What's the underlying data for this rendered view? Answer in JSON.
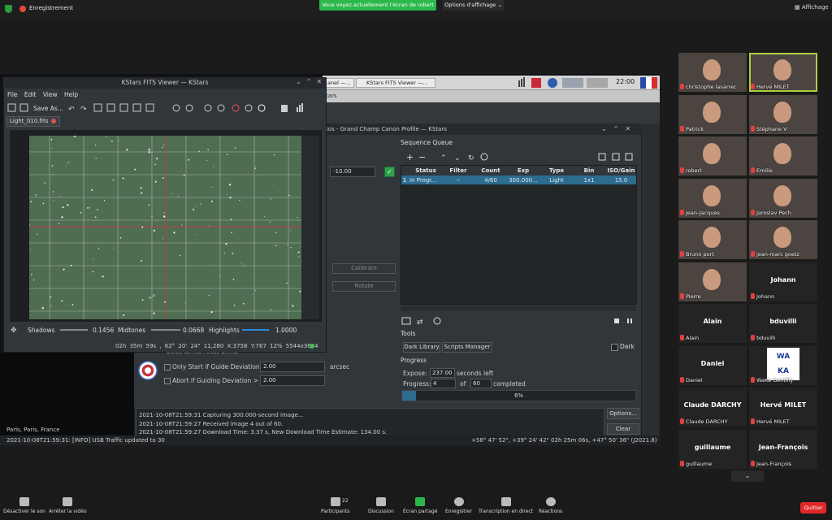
{
  "top": {
    "recording": "Enregistrement",
    "banner": "Vous voyez actuellement l'écran de robert",
    "view_options": "Options d'affichage",
    "display": "Affichage"
  },
  "taskbar": {
    "task1": "anel —...",
    "task2": "KStars FITS Viewer —...",
    "clock": "22:00"
  },
  "kstars": {
    "title": "tars",
    "ekos_title": "kos - Grand Champ Canon Profile — KStars"
  },
  "sequence": {
    "label": "Sequence Queue",
    "columns": [
      "Status",
      "Filter",
      "Count",
      "Exp",
      "Type",
      "Bin",
      "ISO/Gain"
    ],
    "row": {
      "num": "1",
      "status": "In Progr...",
      "filter": "--",
      "count": "4/60",
      "exp": "300.000...",
      "type": "Light",
      "bin": "1x1",
      "iso": "15.0"
    }
  },
  "tools": {
    "label": "Tools",
    "dark_library": "Dark Library",
    "scripts_manager": "Scripts Manager",
    "dark": "Dark"
  },
  "progress": {
    "label": "Progress",
    "expose": "Expose:",
    "expose_value": "237.00",
    "seconds_left": "seconds left",
    "progress": "Progress:",
    "done": "4",
    "of": "of",
    "total": "60",
    "completed": "completed",
    "percent": "6%",
    "fraction": 0.06
  },
  "log": {
    "lines": [
      "2021-10-08T21:59:31 Capturing 300.000-second image...",
      "2021-10-08T21:59:27 Received image 4 out of 60.",
      "2021-10-08T21:59:27 Download Time: 3.37 s, New Download Time Estimate: 134.00 s."
    ],
    "options": "Options...",
    "clear": "Clear"
  },
  "guide": {
    "tabs": "Guide Limits    Focus Limits",
    "only_start": "Only Start if Guide Deviation <",
    "only_start_value": "2.00",
    "arcsec": "arcsec",
    "abort": "Abort if Guiding Deviation >",
    "abort_value": "2.00"
  },
  "camera": {
    "temp": "-10.00",
    "calibrate": "Calibrate",
    "rotate": "Rotate"
  },
  "fits": {
    "title": "KStars FITS Viewer — KStars",
    "menu": "File Edit View Help",
    "save_as": "Save As...",
    "tab": "Light_010.fits",
    "shadows": "Shadows",
    "shadows_val": "0.1456",
    "midtones": "Midtones",
    "midtones_val": "0.0668",
    "highlights": "Highlights",
    "highlights_val": "1.0000",
    "status": "02h 35m 59s , 62° 20' 24\"  11,280   X:3758 Y:767   12%   5544x3684"
  },
  "sky": {
    "location": "Paris, Paris, France"
  },
  "statusbar": {
    "left": "2021-10-08T21:59:31: [INFO] USB Traffic updated to 30",
    "right": "+58° 47' 52\", +39° 24' 42\"  02h 25m 06s, +47° 50' 36\" (J2021.8)"
  },
  "participants": [
    {
      "name": "christophe lavarrec",
      "video": true
    },
    {
      "name": "Hervé MILET",
      "video": true,
      "active": true
    },
    {
      "name": "Patrick",
      "video": true
    },
    {
      "name": "Stéphane V",
      "video": true
    },
    {
      "name": "robert",
      "video": true
    },
    {
      "name": "Emilie",
      "video": true
    },
    {
      "name": "Jean-Jacques",
      "video": true
    },
    {
      "name": "Jaroslav Pech",
      "video": true
    },
    {
      "name": "Bruno port",
      "video": true
    },
    {
      "name": "jean-marc goetz",
      "video": true
    },
    {
      "name": "Pierre",
      "video": true
    },
    {
      "name": "Johann",
      "big": "Johann"
    },
    {
      "name": "Alain",
      "big": "Alain"
    },
    {
      "name": "bduvilli",
      "big": "bduvilli"
    },
    {
      "name": "Daniel",
      "big": "Daniel"
    },
    {
      "name": "WaKa Gentilly",
      "logo": "WA KA"
    },
    {
      "name": "Claude DARCHY",
      "big": "Claude DARCHY"
    },
    {
      "name": "Hervé MILET",
      "big": "Hervé MILET"
    },
    {
      "name": "guillaume",
      "big": "guillaume"
    },
    {
      "name": "Jean-François",
      "big": "Jean-François"
    }
  ],
  "bottom": {
    "mute": "Désactiver le son",
    "stop_video": "Arrêter la vidéo",
    "participants": "Participants",
    "participants_count": "22",
    "discussion": "Discussion",
    "share": "Écran partagé",
    "record": "Enregistrer",
    "transcript": "Transcription en direct",
    "reactions": "Réactions",
    "quit": "Quitter"
  },
  "colors": {
    "accent_green": "#2db84b",
    "progress": "#2d6b8f",
    "quit": "#e02828"
  }
}
